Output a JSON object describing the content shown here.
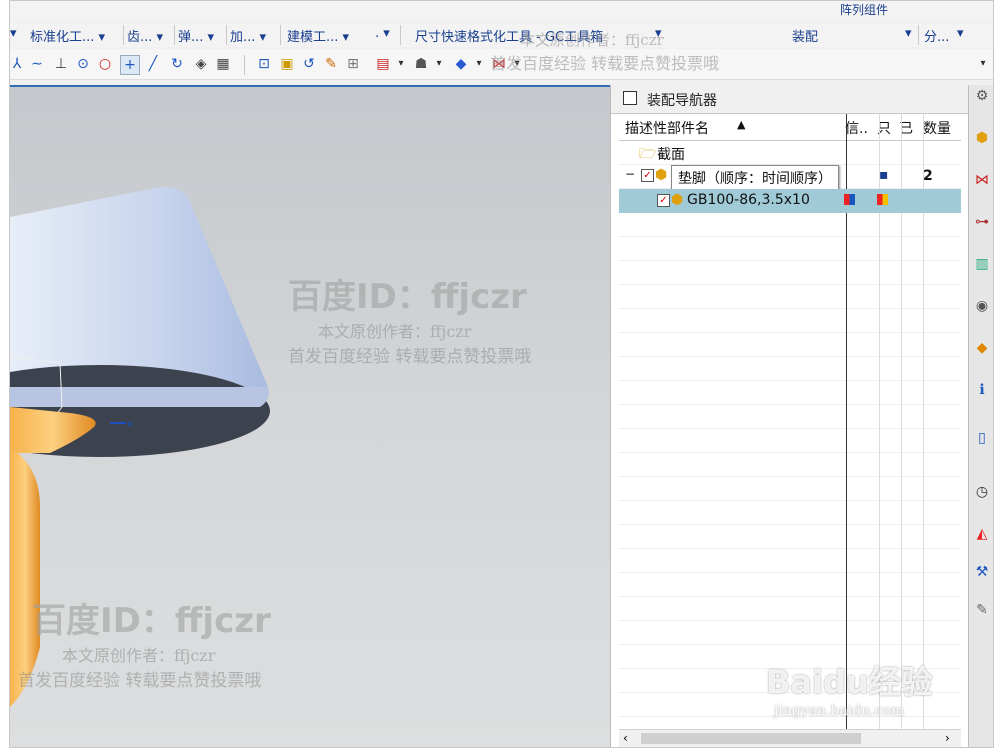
{
  "menu": {
    "items": [
      "▾",
      "标准化工... ▾",
      "齿... ▾",
      "弹... ▾",
      "加... ▾",
      "建模工... ▾",
      ". ▾",
      "尺寸快速格式化工具 - GC工具箱",
      "▾",
      "装配",
      "▾",
      "分...",
      "▾"
    ],
    "top_item": "阵列组件"
  },
  "navigator": {
    "title": "装配导航器",
    "columns": [
      "描述性部件名",
      "信..",
      "只",
      "已",
      "数量"
    ],
    "rows": [
      {
        "name": "截面",
        "qty": ""
      },
      {
        "name": "垫脚（顺序：时间顺序）",
        "qty": "2"
      },
      {
        "name": "GB100-86,3.5x10",
        "qty": ""
      }
    ]
  },
  "watermarks": {
    "id_text": "百度ID：ffjczr",
    "author": "本文原创作者：ffjczr",
    "note": "首发百度经验 转载要点赞投票哦",
    "logo": "Baidu经验",
    "url": "jingyan.baidu.com"
  },
  "colors": {
    "accent": "#2f6db6",
    "selection": "#9fcad6",
    "lampshade": "#c9d6ee",
    "lamp_base": "#f0a23a"
  }
}
